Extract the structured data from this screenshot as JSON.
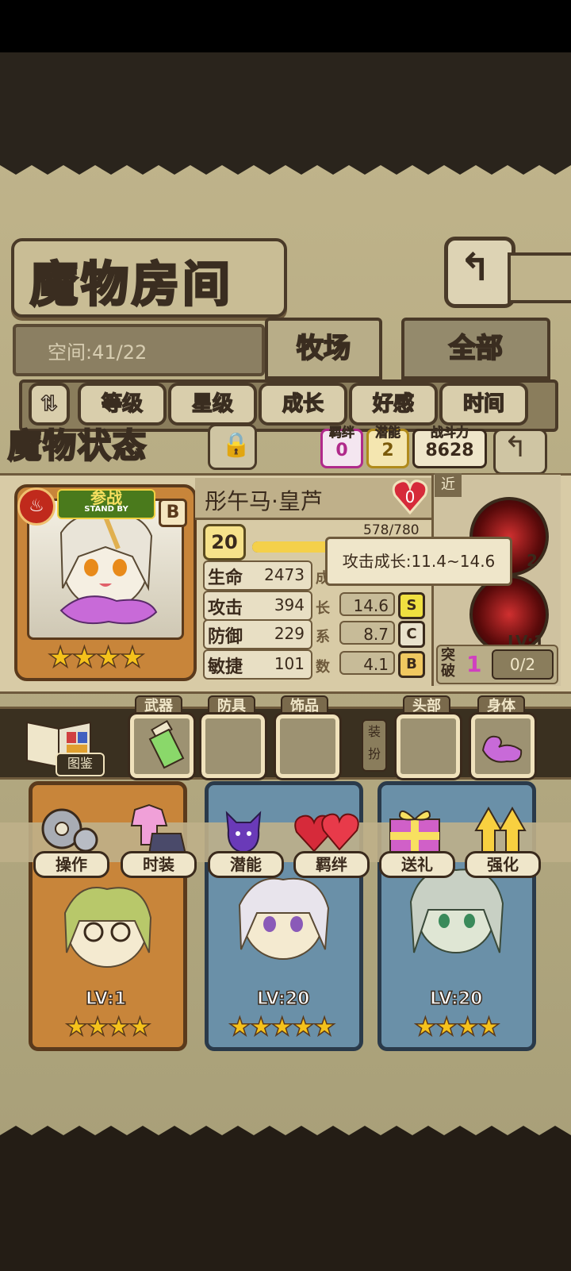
{
  "header": {
    "title": "魔物房间",
    "back_icon": "return-arrow-icon"
  },
  "space": {
    "label": "空间:41/22"
  },
  "tabs": [
    {
      "label": "牧场",
      "active": true
    },
    {
      "label": "全部",
      "active": false
    }
  ],
  "filters": [
    "等级",
    "星级",
    "成长",
    "好感",
    "时间"
  ],
  "status": {
    "title": "魔物状态",
    "bond": {
      "label": "羁绊",
      "value": "0"
    },
    "potential": {
      "label": "潜能",
      "value": "2"
    },
    "power": {
      "label": "战斗力",
      "value": "8628"
    }
  },
  "monster": {
    "banner": "参战",
    "banner_sub": "STAND BY",
    "grade": "B",
    "name": "彤午马·皇芦",
    "heart_value": "0",
    "level": "20",
    "exp_text": "578/780",
    "exp_ratio": 0.741,
    "stars": "★★★★",
    "stats": [
      {
        "label": "生命",
        "value": "2473"
      },
      {
        "label": "攻击",
        "value": "394",
        "growth": "14.6",
        "grade": "S"
      },
      {
        "label": "防御",
        "value": "229",
        "growth": "8.7",
        "grade": "C"
      },
      {
        "label": "敏捷",
        "value": "101",
        "growth": "4.1",
        "grade": "B"
      }
    ],
    "growth_side_chars": [
      "成",
      "长",
      "系",
      "数"
    ],
    "tooltip": "攻击成长:11.4~14.6",
    "range": "近",
    "skill1_lv": "2",
    "skill2_lv": "LV:1",
    "break": {
      "label": "突破",
      "count": "1",
      "progress": "0/2"
    }
  },
  "equipment": {
    "codex": "图鉴",
    "dress_label": "装扮",
    "slots": [
      "武器",
      "防具",
      "饰品",
      "头部",
      "身体"
    ]
  },
  "actions": [
    "操作",
    "时装",
    "潜能",
    "羁绊",
    "送礼",
    "强化"
  ],
  "cards": [
    {
      "lv": "LV:1",
      "stars": "★★★★"
    },
    {
      "lv": "LV:20",
      "stars": "★★★★★"
    },
    {
      "lv": "LV:20",
      "stars": "★★★★"
    }
  ],
  "colors": {
    "parchment": "#bfb38a",
    "accent_gold": "#f5c21b",
    "frame_dark": "#3a2a1c",
    "tooltip_bg": "#efe6ca"
  }
}
